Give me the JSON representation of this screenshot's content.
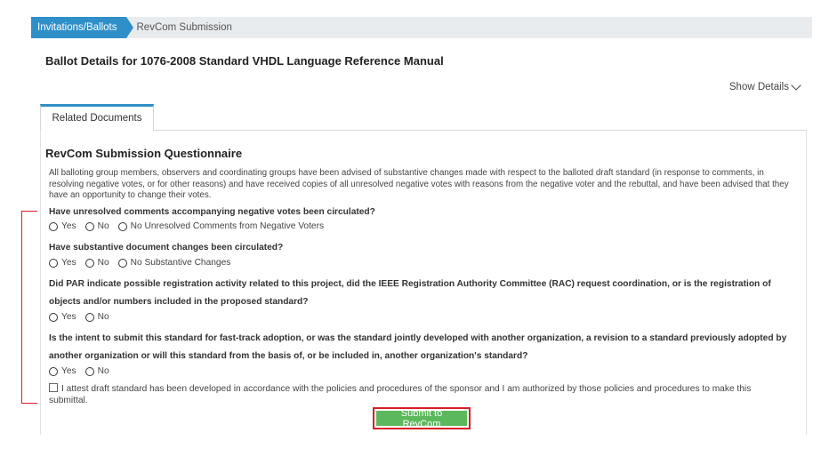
{
  "breadcrumb": {
    "items": [
      "Invitations/Ballots",
      "RevCom Submission"
    ]
  },
  "page_title": "Ballot Details for 1076-2008 Standard VHDL Language Reference Manual",
  "show_details": "Show Details",
  "tabs": [
    {
      "label": "Related Documents"
    }
  ],
  "questionnaire": {
    "title": "RevCom Submission Questionnaire",
    "intro": "All balloting group members, observers and coordinating groups have been advised of substantive changes made with respect to the balloted draft standard (in response to comments, in resolving negative votes, or for other reasons) and have received copies of all unresolved negative votes with reasons from the negative voter and the rebuttal, and have been advised that they have an opportunity to change their votes.",
    "questions": [
      {
        "text": "Have unresolved comments accompanying negative votes been circulated?",
        "options": [
          "Yes",
          "No",
          "No Unresolved Comments from Negative Voters"
        ]
      },
      {
        "text": "Have substantive document changes been circulated?",
        "options": [
          "Yes",
          "No",
          "No Substantive Changes"
        ]
      },
      {
        "text": "Did PAR indicate possible registration activity related to this project, did the IEEE Registration Authority Committee (RAC) request coordination, or is the registration of objects and/or numbers included in the proposed standard?",
        "options": [
          "Yes",
          "No"
        ]
      },
      {
        "text": "Is the intent to submit this standard for fast-track adoption, or was the standard jointly developed with another organization, a revision to a standard previously adopted by another organization or will this standard from the basis of, or be included in, another organization's standard?",
        "options": [
          "Yes",
          "No"
        ]
      }
    ],
    "attestation": "I attest draft standard has been developed in accordance with the policies and procedures of the sponsor and I am authorized by those policies and procedures to make this submittal.",
    "submit_label": "Submit to RevCom"
  },
  "colors": {
    "accent": "#2f8fc9",
    "submit": "#5cb85c",
    "annotation": "#d81f26"
  }
}
